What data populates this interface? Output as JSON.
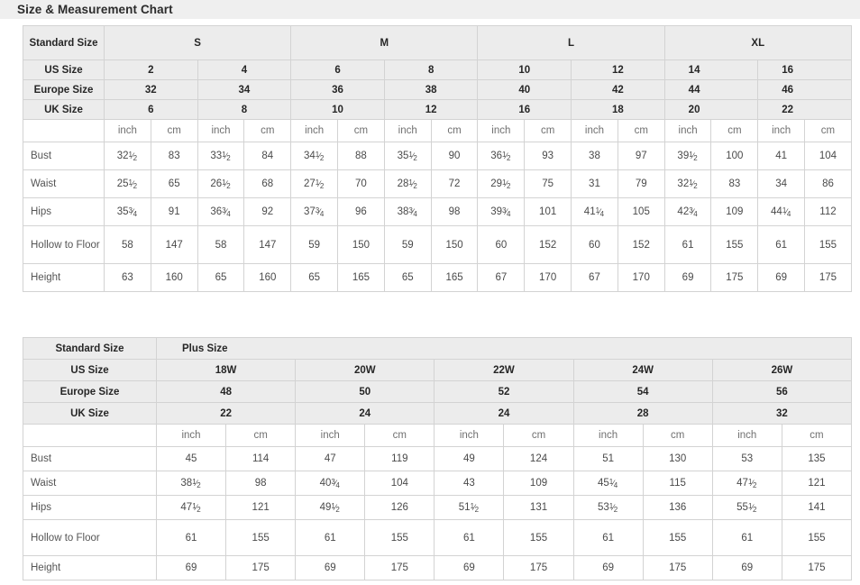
{
  "page": {
    "title": "Size & Measurement Chart",
    "background_color": "#ffffff",
    "band_color": "#efefef",
    "header_cell_color": "#ececec",
    "border_color": "#d3d3d3"
  },
  "standard_table": {
    "label_column_header": "Standard Size",
    "size_groups": [
      "S",
      "M",
      "L",
      "XL"
    ],
    "row_headers": {
      "us": "US Size",
      "europe": "Europe Size",
      "uk": "UK Size"
    },
    "us_sizes": [
      "2",
      "4",
      "6",
      "8",
      "10",
      "12",
      "14",
      "16"
    ],
    "europe_sizes": [
      "32",
      "34",
      "36",
      "38",
      "40",
      "42",
      "44",
      "46"
    ],
    "uk_sizes": [
      "6",
      "8",
      "10",
      "12",
      "16",
      "18",
      "20",
      "22"
    ],
    "units": [
      "inch",
      "cm",
      "inch",
      "cm",
      "inch",
      "cm",
      "inch",
      "cm",
      "inch",
      "cm",
      "inch",
      "cm",
      "inch",
      "cm",
      "inch",
      "cm"
    ],
    "unit_inch": "inch",
    "unit_cm": "cm",
    "measurements": [
      {
        "label": "Bust",
        "inch": [
          "32 1/2",
          "33 1/2",
          "34 1/2",
          "35 1/2",
          "36 1/2",
          "38",
          "39 1/2",
          "41"
        ],
        "cm": [
          "83",
          "84",
          "88",
          "90",
          "93",
          "97",
          "100",
          "104"
        ]
      },
      {
        "label": "Waist",
        "inch": [
          "25 1/2",
          "26 1/2",
          "27 1/2",
          "28 1/2",
          "29 1/2",
          "31",
          "32 1/2",
          "34"
        ],
        "cm": [
          "65",
          "68",
          "70",
          "72",
          "75",
          "79",
          "83",
          "86"
        ]
      },
      {
        "label": "Hips",
        "inch": [
          "35 3/4",
          "36 3/4",
          "37 3/4",
          "38 3/4",
          "39 3/4",
          "41 1/4",
          "42 3/4",
          "44 1/4"
        ],
        "cm": [
          "91",
          "92",
          "96",
          "98",
          "101",
          "105",
          "109",
          "112"
        ]
      },
      {
        "label": "Hollow to Floor",
        "inch": [
          "58",
          "58",
          "59",
          "59",
          "60",
          "60",
          "61",
          "61"
        ],
        "cm": [
          "147",
          "147",
          "150",
          "150",
          "152",
          "152",
          "155",
          "155"
        ]
      },
      {
        "label": "Height",
        "inch": [
          "63",
          "65",
          "65",
          "65",
          "67",
          "67",
          "69",
          "69"
        ],
        "cm": [
          "160",
          "160",
          "165",
          "165",
          "170",
          "170",
          "175",
          "175"
        ]
      }
    ]
  },
  "plus_table": {
    "label_column_header": "Standard Size",
    "group_label": "Plus Size",
    "row_headers": {
      "us": "US Size",
      "europe": "Europe Size",
      "uk": "UK Size"
    },
    "us_sizes": [
      "18W",
      "20W",
      "22W",
      "24W",
      "26W"
    ],
    "europe_sizes": [
      "48",
      "50",
      "52",
      "54",
      "56"
    ],
    "uk_sizes": [
      "22",
      "24",
      "24",
      "28",
      "32"
    ],
    "unit_inch": "inch",
    "unit_cm": "cm",
    "measurements": [
      {
        "label": "Bust",
        "inch": [
          "45",
          "47",
          "49",
          "51",
          "53"
        ],
        "cm": [
          "114",
          "119",
          "124",
          "130",
          "135"
        ]
      },
      {
        "label": "Waist",
        "inch": [
          "38 1/2",
          "40 3/4",
          "43",
          "45 1/4",
          "47 1/2"
        ],
        "cm": [
          "98",
          "104",
          "109",
          "115",
          "121"
        ]
      },
      {
        "label": "Hips",
        "inch": [
          "47 1/2",
          "49 1/2",
          "51 1/2",
          "53 1/2",
          "55 1/2"
        ],
        "cm": [
          "121",
          "126",
          "131",
          "136",
          "141"
        ]
      },
      {
        "label": "Hollow to Floor",
        "inch": [
          "61",
          "61",
          "61",
          "61",
          "61"
        ],
        "cm": [
          "155",
          "155",
          "155",
          "155",
          "155"
        ]
      },
      {
        "label": "Height",
        "inch": [
          "69",
          "69",
          "69",
          "69",
          "69"
        ],
        "cm": [
          "175",
          "175",
          "175",
          "175",
          "175"
        ]
      }
    ]
  }
}
